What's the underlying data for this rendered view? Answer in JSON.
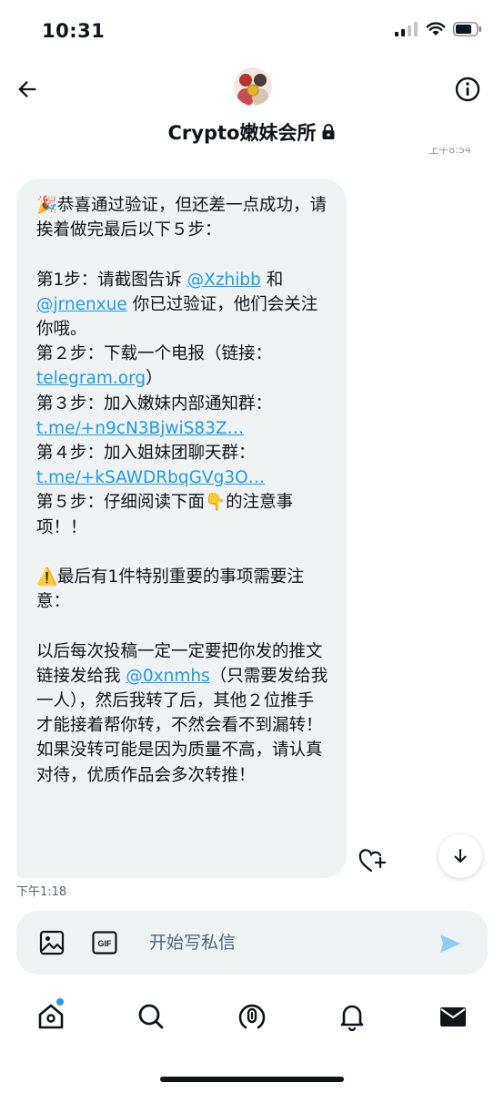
{
  "status_bar": {
    "time": "10:31"
  },
  "header": {
    "title": "Crypto嫩妹会所",
    "partial_timestamp": "上午8:54"
  },
  "message": {
    "paragraphs": [
      {
        "emoji": "🎉",
        "text": "恭喜通过验证，但还差一点成功，请挨着做完最后以下５步："
      },
      {
        "gap": true
      },
      {
        "text_before": "第1步：请截图告诉 ",
        "link1": "@Xzhibb",
        "text_mid": " 和 ",
        "link2": "@jrnenxue",
        "text_after": " 你已过验证，他们会关注你哦。"
      },
      {
        "text": "第２步：下载一个电报（链接：",
        "link": "telegram.org",
        "text_after": "）"
      },
      {
        "text": "第３步：加入嫩妹内部通知群：",
        "link": "t.me/+n9cN3BjwiS83Z…"
      },
      {
        "text": "第４步：加入姐妹团聊天群：",
        "link": "t.me/+kSAWDRbqGVg3O…"
      },
      {
        "text": "第５步：仔细阅读下面",
        "emoji": "👇",
        "text_after": "的注意事项！！"
      },
      {
        "gap": true
      },
      {
        "emoji": "⚠️",
        "text": "最后有1件特别重要的事项需要注意："
      },
      {
        "gap": true
      },
      {
        "text_before": "以后每次投稿一定一定要把你发的推文链接发给我 ",
        "link": "@0xnmhs",
        "text_after": "（只需要发给我一人），然后我转了后，其他２位推手才能接着帮你转，不然会看不到漏转！如果没转可能是因为质量不高，请认真对待，优质作品会多次转推！"
      }
    ],
    "time": "下午1:18"
  },
  "composer": {
    "placeholder": "开始写私信"
  },
  "colors": {
    "accent": "#1d9bf0",
    "bubble": "#eff3f4",
    "text": "#0f1419",
    "muted": "#536471"
  },
  "icons": {
    "back": "arrow-left-icon",
    "info": "info-icon",
    "lock": "lock-icon",
    "image": "image-icon",
    "gif": "gif-icon",
    "send": "send-icon",
    "react": "heart-plus-icon",
    "scroll": "arrow-down-icon",
    "nav": [
      "home-icon",
      "search-icon",
      "spaces-icon",
      "bell-icon",
      "mail-icon"
    ]
  }
}
